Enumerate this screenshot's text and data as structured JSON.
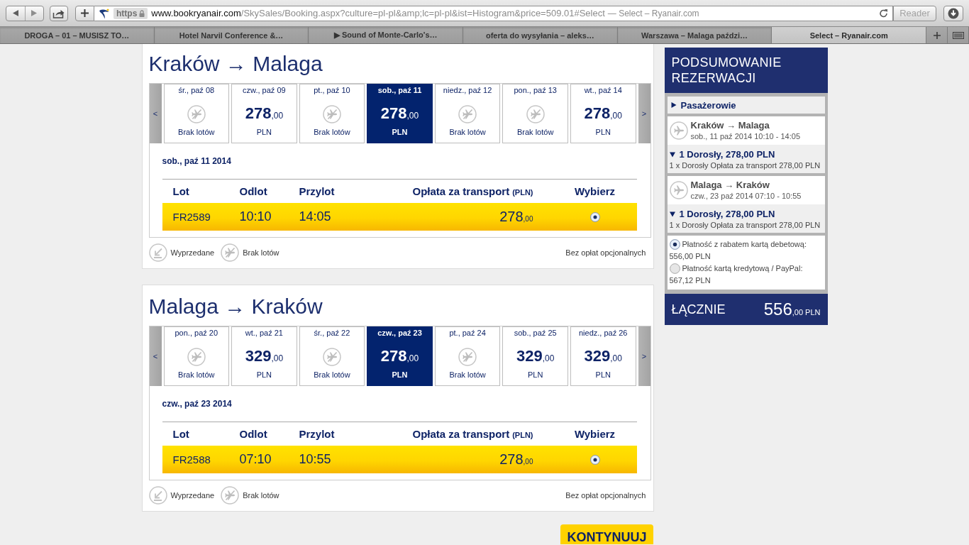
{
  "browser": {
    "toolbar": {
      "protocol": "https",
      "host": "www.bookryanair.com",
      "path": "/SkySales/Booking.aspx?culture=pl-pl&amp;lc=pl-pl&ist=Histogram&price=509.01#Select",
      "page_title": "— Select – Ryanair.com",
      "reader": {
        "label": "Reader",
        "disabled": true
      }
    },
    "tabs": [
      {
        "label": "DROGA – 01 – MUSISZ TO…",
        "selected": false
      },
      {
        "label": "Hotel Narvil Conference &…",
        "selected": false
      },
      {
        "label": "▶ Sound of Monte-Carlo's…",
        "selected": false
      },
      {
        "label": "oferta do wysyłania – aleks…",
        "selected": false
      },
      {
        "label": "Warszawa – Malaga paździ…",
        "selected": false
      },
      {
        "label": "Select – Ryanair.com",
        "selected": true
      }
    ]
  },
  "journeys": [
    {
      "title": "Kraków → Malaga",
      "prev": "<",
      "next": ">",
      "dates": [
        {
          "day": "śr., paź 08",
          "kind": "no-flights",
          "status": "Brak lotów",
          "selected": false
        },
        {
          "day": "czw., paź 09",
          "kind": "fare",
          "amount": "278",
          "fraction": ",00",
          "currency": "PLN",
          "selected": false
        },
        {
          "day": "pt., paź 10",
          "kind": "no-flights",
          "status": "Brak lotów",
          "selected": false
        },
        {
          "day": "sob., paź 11",
          "kind": "fare",
          "amount": "278",
          "fraction": ",00",
          "currency": "PLN",
          "selected": true
        },
        {
          "day": "niedz., paź 12",
          "kind": "no-flights",
          "status": "Brak lotów",
          "selected": false
        },
        {
          "day": "pon., paź 13",
          "kind": "no-flights",
          "status": "Brak lotów",
          "selected": false
        },
        {
          "day": "wt., paź 14",
          "kind": "fare",
          "amount": "278",
          "fraction": ",00",
          "currency": "PLN",
          "selected": false
        }
      ],
      "selected_date": "sob., paź 11 2014",
      "columns": [
        {
          "label": "Lot"
        },
        {
          "label": "Odlot"
        },
        {
          "label": "Przylot"
        },
        {
          "label": "Opłata za transport",
          "unit": "(PLN)"
        },
        {
          "label": "Wybierz"
        }
      ],
      "flights": [
        {
          "number": "FR2589",
          "departure": "10:10",
          "arrival": "14:05",
          "amount": "278",
          "fraction": ",00",
          "selected": true
        }
      ],
      "legend": [
        {
          "kind": "sold-out",
          "label": "Wyprzedane"
        },
        {
          "kind": "no-flights",
          "label": "Brak lotów"
        }
      ],
      "note": "Bez opłat opcjonalnych"
    },
    {
      "title": "Malaga → Kraków",
      "prev": "<",
      "next": ">",
      "dates": [
        {
          "day": "pon., paź 20",
          "kind": "no-flights",
          "status": "Brak lotów",
          "selected": false
        },
        {
          "day": "wt., paź 21",
          "kind": "fare",
          "amount": "329",
          "fraction": ",00",
          "currency": "PLN",
          "selected": false
        },
        {
          "day": "śr., paź 22",
          "kind": "no-flights",
          "status": "Brak lotów",
          "selected": false
        },
        {
          "day": "czw., paź 23",
          "kind": "fare",
          "amount": "278",
          "fraction": ",00",
          "currency": "PLN",
          "selected": true
        },
        {
          "day": "pt., paź 24",
          "kind": "no-flights",
          "status": "Brak lotów",
          "selected": false
        },
        {
          "day": "sob., paź 25",
          "kind": "fare",
          "amount": "329",
          "fraction": ",00",
          "currency": "PLN",
          "selected": false
        },
        {
          "day": "niedz., paź 26",
          "kind": "fare",
          "amount": "329",
          "fraction": ",00",
          "currency": "PLN",
          "selected": false
        }
      ],
      "selected_date": "czw., paź 23 2014",
      "columns": [
        {
          "label": "Lot"
        },
        {
          "label": "Odlot"
        },
        {
          "label": "Przylot"
        },
        {
          "label": "Opłata za transport",
          "unit": "(PLN)"
        },
        {
          "label": "Wybierz"
        }
      ],
      "flights": [
        {
          "number": "FR2588",
          "departure": "07:10",
          "arrival": "10:55",
          "amount": "278",
          "fraction": ",00",
          "selected": true
        }
      ],
      "legend": [
        {
          "kind": "sold-out",
          "label": "Wyprzedane"
        },
        {
          "kind": "no-flights",
          "label": "Brak lotów"
        }
      ],
      "note": "Bez opłat opcjonalnych"
    }
  ],
  "summary": {
    "title": "PODSUMOWANIE REZERWACJI",
    "passengers": {
      "label": "Pasażerowie",
      "expanded": false
    },
    "legs": [
      {
        "route": "Kraków → Malaga",
        "when": "sob., 11 paź 2014 10:10 - 14:05",
        "fare": "1 Dorosły, 278,00 PLN",
        "expanded": true,
        "detail": "1 x Dorosły Opłata za transport 278,00 PLN"
      },
      {
        "route": "Malaga → Kraków",
        "when": "czw., 23 paź 2014 07:10 - 10:55",
        "fare": "1 Dorosły, 278,00 PLN",
        "expanded": true,
        "detail": "1 x Dorosły Opłata za transport 278,00 PLN"
      }
    ],
    "payment_options": [
      {
        "label": "Płatność z rabatem kartą debetową:",
        "amount": "556,00 PLN",
        "selected": true
      },
      {
        "label": "Płatność kartą kredytową / PayPal:",
        "amount": "567,12 PLN",
        "selected": false
      }
    ],
    "total": {
      "label": "ŁĄCZNIE",
      "amount": "556",
      "suffix": ",00 PLN"
    }
  },
  "continue_button": "KONTYNUUJ"
}
